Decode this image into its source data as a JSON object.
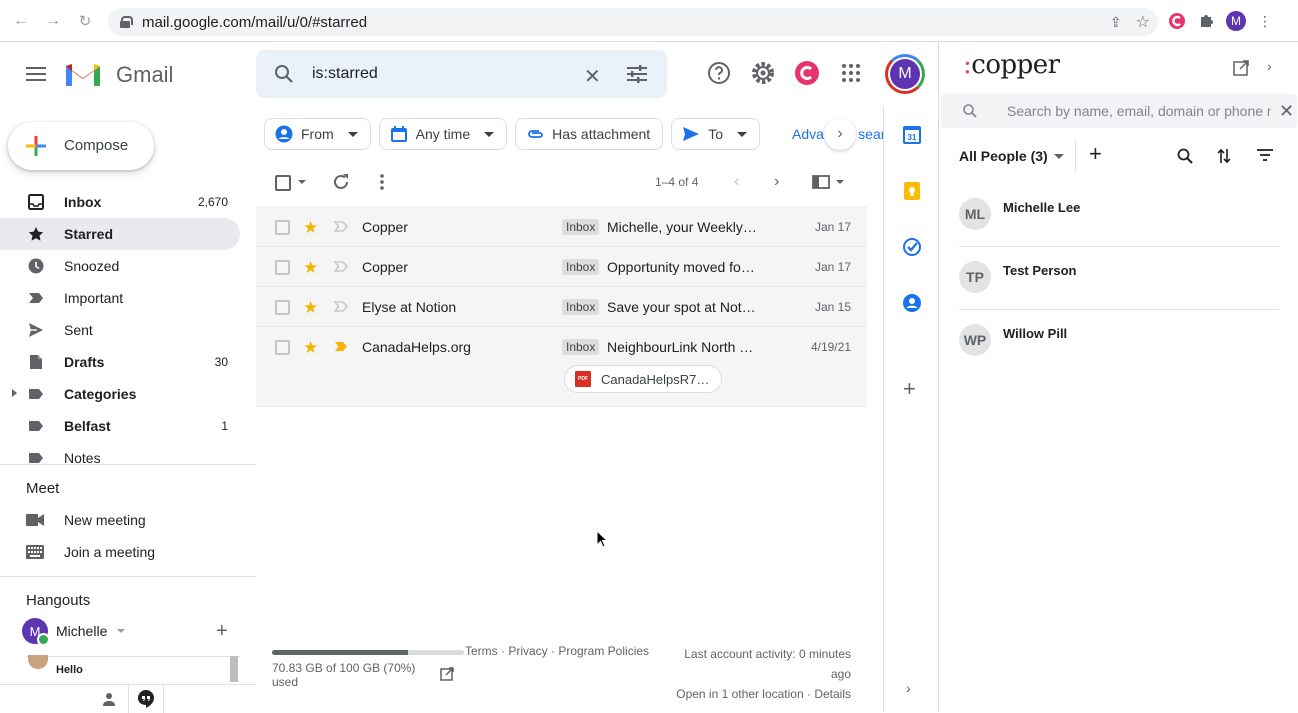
{
  "browser": {
    "url": "mail.google.com/mail/u/0/#starred",
    "profile_initial": "M"
  },
  "header": {
    "app_name": "Gmail",
    "search_query": "is:starred",
    "account_initial": "M"
  },
  "compose_label": "Compose",
  "nav": {
    "items": [
      {
        "label": "Inbox",
        "count": "2,670",
        "icon": "inbox-icon"
      },
      {
        "label": "Starred",
        "count": "",
        "icon": "star-icon"
      },
      {
        "label": "Snoozed",
        "count": "",
        "icon": "clock-icon"
      },
      {
        "label": "Important",
        "count": "",
        "icon": "important-icon"
      },
      {
        "label": "Sent",
        "count": "",
        "icon": "send-icon"
      },
      {
        "label": "Drafts",
        "count": "30",
        "icon": "draft-icon"
      },
      {
        "label": "Categories",
        "count": "",
        "icon": "label-icon"
      },
      {
        "label": "Belfast",
        "count": "1",
        "icon": "label-icon"
      },
      {
        "label": "Notes",
        "count": "",
        "icon": "label-icon"
      }
    ]
  },
  "meet": {
    "title": "Meet",
    "new_meeting": "New meeting",
    "join_meeting": "Join a meeting"
  },
  "hangouts": {
    "title": "Hangouts",
    "user": "Michelle",
    "user_initial": "M",
    "conversation": "Hello"
  },
  "filters": {
    "from": "From",
    "any_time": "Any time",
    "has_attachment": "Has attachment",
    "to": "To",
    "advanced": "Advanced search"
  },
  "toolbar": {
    "range": "1–4 of 4"
  },
  "emails": [
    {
      "sender": "Copper",
      "label": "Inbox",
      "subject": "Michelle, your Weekly…",
      "date": "Jan 17",
      "important": false
    },
    {
      "sender": "Copper",
      "label": "Inbox",
      "subject": "Opportunity moved fo…",
      "date": "Jan 17",
      "important": false
    },
    {
      "sender": "Elyse at Notion",
      "label": "Inbox",
      "subject": "Save your spot at Not…",
      "date": "Jan 15",
      "important": false
    },
    {
      "sender": "CanadaHelps.org",
      "label": "Inbox",
      "subject": "NeighbourLink North …",
      "date": "4/19/21",
      "important": true,
      "attachment": "CanadaHelpsR7…"
    }
  ],
  "footer": {
    "storage_used_fraction": 0.7083,
    "storage_text": "70.83 GB of 100 GB (70%) used",
    "links": "Terms · Privacy · Program Policies",
    "activity": "Last account activity: 0 minutes ago",
    "other_location": "Open in 1 other location · Details"
  },
  "copper": {
    "brand": "copper",
    "search_placeholder": "Search by name, email, domain or phone number",
    "filter_label": "All People (3)",
    "people": [
      {
        "initials": "ML",
        "name": "Michelle Lee"
      },
      {
        "initials": "TP",
        "name": "Test Person"
      },
      {
        "initials": "WP",
        "name": "Willow Pill"
      }
    ]
  },
  "colors": {
    "accent_blue": "#1a73e8",
    "star": "#f4b400",
    "copper_pink": "#ee3c6b",
    "avatar_purple": "#5e35b1"
  }
}
